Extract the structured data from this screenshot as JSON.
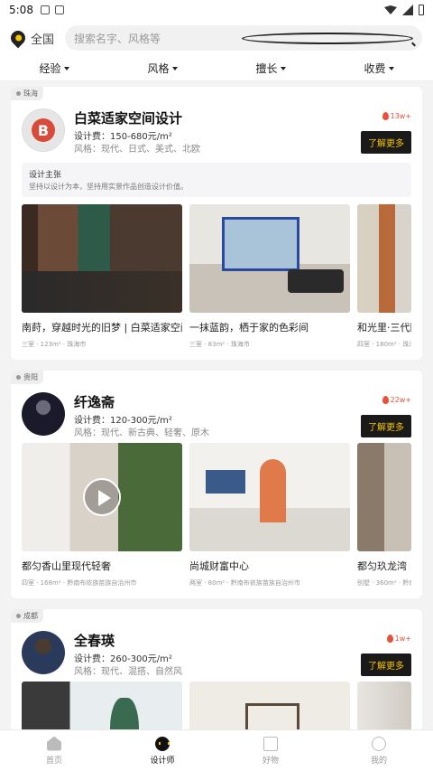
{
  "status": {
    "time": "5:08"
  },
  "header": {
    "location": "全国",
    "search_placeholder": "搜索名字、风格等"
  },
  "filters": [
    "经验",
    "风格",
    "擅长",
    "收费"
  ],
  "designers": [
    {
      "city": "珠海",
      "name": "白菜适家空间设计",
      "fee": "设计费：150-680元/m²",
      "style": "风格：现代、日式、美式、北欧",
      "popularity": "13w+",
      "more": "了解更多",
      "pitch_title": "设计主张",
      "pitch_text": "坚持以设计为本，坚持用实景作品创造设计价值。",
      "logo_letter": "B",
      "works": [
        {
          "title": "南莳，穿越时光的旧梦 | 白菜适家空间...",
          "meta": "三室 · 123m² · 珠海市"
        },
        {
          "title": "一抹蓝韵，栖于家的色彩间",
          "meta": "三室 · 83m² · 珠海市"
        },
        {
          "title": "和光里·三代同",
          "meta": "四室 · 180m² · 珠海"
        }
      ]
    },
    {
      "city": "贵阳",
      "name": "纤逸斋",
      "fee": "设计费：120-300元/m²",
      "style": "风格：现代、新古典、轻奢、原木",
      "popularity": "22w+",
      "more": "了解更多",
      "works": [
        {
          "title": "都匀香山里现代轻奢",
          "meta": "四室 · 168m² · 黔南布依族苗族自治州市"
        },
        {
          "title": "尚城财富中心",
          "meta": "两室 · 80m² · 黔南布依族苗族自治州市"
        },
        {
          "title": "都匀玖龙湾",
          "meta": "别墅 · 360m² · 黔南"
        }
      ]
    },
    {
      "city": "成都",
      "name": "全春瑛",
      "fee": "设计费：260-300元/m²",
      "style": "风格：现代、混搭、自然风",
      "popularity": "1w+",
      "more": "了解更多",
      "works": []
    }
  ],
  "nav": [
    {
      "label": "首页",
      "icon": "home-icon"
    },
    {
      "label": "设计师",
      "icon": "designer-icon"
    },
    {
      "label": "好物",
      "icon": "goods-icon"
    },
    {
      "label": "我的",
      "icon": "profile-icon"
    }
  ],
  "colors": {
    "accent": "#f5c400",
    "hot": "#e8503a",
    "dark": "#1a1a1a"
  }
}
